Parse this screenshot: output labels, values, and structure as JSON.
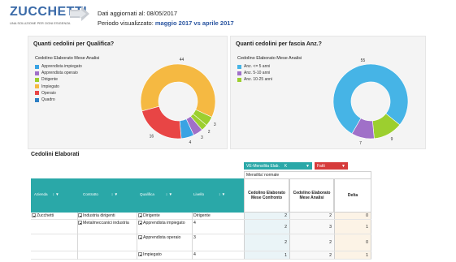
{
  "header": {
    "logo": "ZUCCHETTI",
    "logo_tagline": "UNA SOLUZIONE PER OGNI ESIGENZA",
    "updated_label": "Dati aggiornati al: 08/05/2017",
    "period_label": "Periodo visualizzato:",
    "period_value": "maggio 2017 vs aprile 2017"
  },
  "qualifica_chart": {
    "title": "Quanti cedolini per Qualifica?",
    "legend_header": "Cedolino  Elaborato Mese Analisi",
    "chart_data": {
      "type": "pie",
      "categories": [
        "Apprendista impiegato",
        "Apprendista operaio",
        "Dirigente",
        "Impiegato",
        "Operaio",
        "Quadro"
      ],
      "values": [
        3,
        2,
        2,
        3,
        16,
        4
      ],
      "labeled_values": [
        44,
        3,
        2,
        3,
        4,
        16
      ],
      "colors": [
        "#3aa3e3",
        "#a070c8",
        "#9ccf2f",
        "#f5b942",
        "#e84545",
        "#2d7fc4"
      ]
    }
  },
  "anzianita_chart": {
    "title": "Quanti cedolini per fascia Anz.?",
    "legend_header": "Cedolino  Elaborato Mese Analisi",
    "chart_data": {
      "type": "pie",
      "categories": [
        "Anz. <= 5 anni",
        "Anz. 5-10 anni",
        "Anz. 10-25 anni"
      ],
      "values": [
        55,
        7,
        9
      ],
      "colors": [
        "#46b4e6",
        "#a070c8",
        "#9ccf2f"
      ]
    }
  },
  "table": {
    "title": "Cedolini Elaborati",
    "chip_filter": "VE-Mensilita Elab.",
    "chip_filter_key": "K",
    "chip_facts": "Fatti",
    "measure_group": "Mensilita' normale",
    "dim_headers": [
      "Azienda",
      "Contratto",
      "Qualifica",
      "Livello"
    ],
    "measure_headers": [
      "Cedolino Elaborato Mese Confronto",
      "Cedolino Elaborato Mese Analisi",
      "Delta"
    ],
    "rows": [
      {
        "azienda": "Zucchetti",
        "contratto": "Industria dirigenti",
        "qualifica": "Dirigente",
        "livello": "Dirigente",
        "confronto": "2",
        "analisi": "2",
        "delta": "0"
      },
      {
        "azienda": "",
        "contratto": "Metalmeccanici industria",
        "qualifica": "Apprendista impiegato",
        "livello": "4",
        "confronto": "2",
        "analisi": "3",
        "delta": "1"
      },
      {
        "azienda": "",
        "contratto": "",
        "qualifica": "Apprendista operaio",
        "livello": "3",
        "confronto": "2",
        "analisi": "2",
        "delta": "0"
      },
      {
        "azienda": "",
        "contratto": "",
        "qualifica": "Impiegato",
        "livello": "4",
        "confronto": "1",
        "analisi": "2",
        "delta": "1"
      }
    ]
  }
}
